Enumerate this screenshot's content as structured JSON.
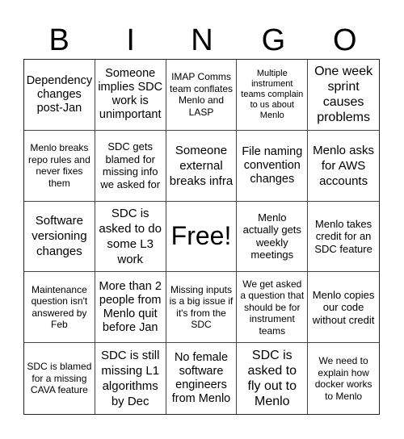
{
  "header": {
    "letters": [
      "B",
      "I",
      "N",
      "G",
      "O"
    ]
  },
  "cells": [
    "Dependency changes post-Jan",
    "Someone implies SDC work is unimportant",
    "IMAP Comms team conflates Menlo and LASP",
    "Multiple instrument teams complain to us about Menlo",
    "One week sprint causes problems",
    "Menlo breaks repo rules and never fixes them",
    "SDC gets blamed for missing info we asked for",
    "Someone external breaks infra",
    "File naming convention changes",
    "Menlo asks for AWS accounts",
    "Software versioning changes",
    "SDC is asked to do some L3 work",
    "Free!",
    "Menlo actually gets weekly meetings",
    "Menlo takes credit for an SDC feature",
    "Maintenance question isn't answered by Feb",
    "More than 2 people from Menlo quit before Jan",
    "Missing inputs is a big issue if it's from the SDC",
    "We get asked a question that should be for instrument teams",
    "Menlo copies our code without credit",
    "SDC is blamed for a missing CAVA feature",
    "SDC is still missing L1 algorithms by Dec",
    "No female software engineers from Menlo",
    "SDC is asked to fly out to Menlo",
    "We need to explain how docker works to Menlo"
  ]
}
